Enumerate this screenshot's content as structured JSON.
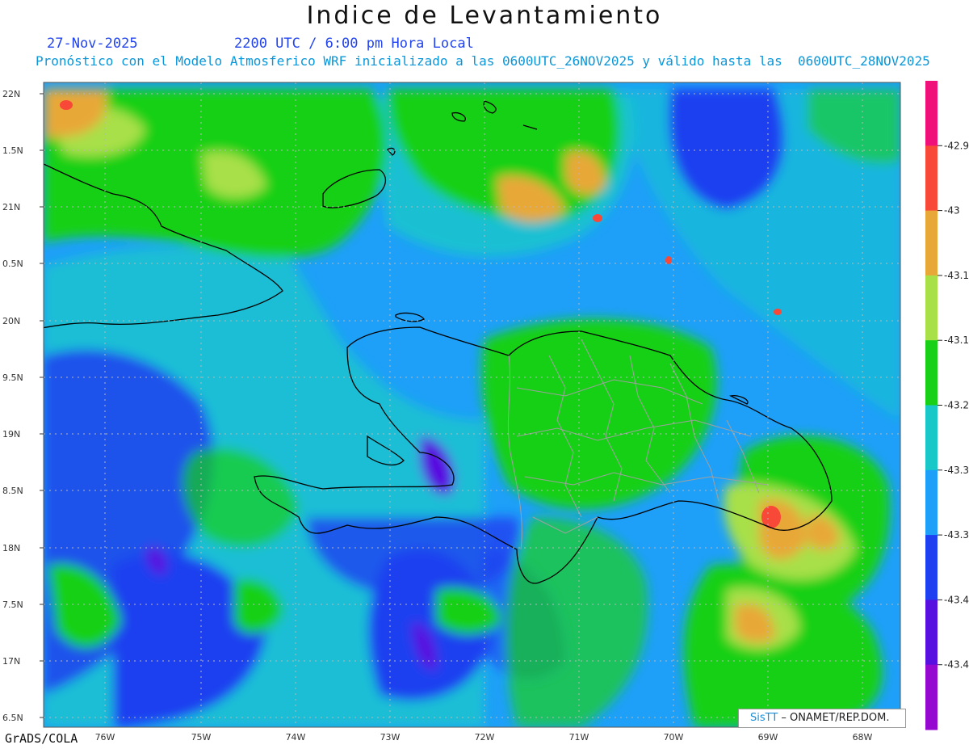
{
  "title": "Indice de Levantamiento",
  "date_line": "27-Nov-2025",
  "time_line": "2200 UTC / 6:00 pm Hora Local",
  "forecast_line": "Pronóstico con el Modelo Atmosferico WRF inicializado a las 0600UTC_26NOV2025 y válido hasta las  0600UTC_28NOV2025",
  "software_label": "GrADS/COLA",
  "credit": {
    "logo_text": "SisTT",
    "org_text": " – ONAMET/REP.DOM."
  },
  "axes": {
    "lon_labels": [
      "76W",
      "75W",
      "74W",
      "73W",
      "72W",
      "71W",
      "70W",
      "69W",
      "68W"
    ],
    "lat_labels": [
      "22N",
      "1.5N",
      "21N",
      "0.5N",
      "20N",
      "9.5N",
      "19N",
      "8.5N",
      "18N",
      "7.5N",
      "17N",
      "6.5N"
    ]
  },
  "colorbar": {
    "colors": [
      "#f0107a",
      "#f84838",
      "#e8a838",
      "#a8e048",
      "#18d018",
      "#18c8c8",
      "#1ea0f8",
      "#1e40f0",
      "#5810e0",
      "#9408d0"
    ],
    "labels": [
      "-42.9",
      "-43",
      "-43.1",
      "-43.1",
      "-43.2",
      "-43.3",
      "-43.3",
      "-43.4",
      "-43.4"
    ]
  }
}
